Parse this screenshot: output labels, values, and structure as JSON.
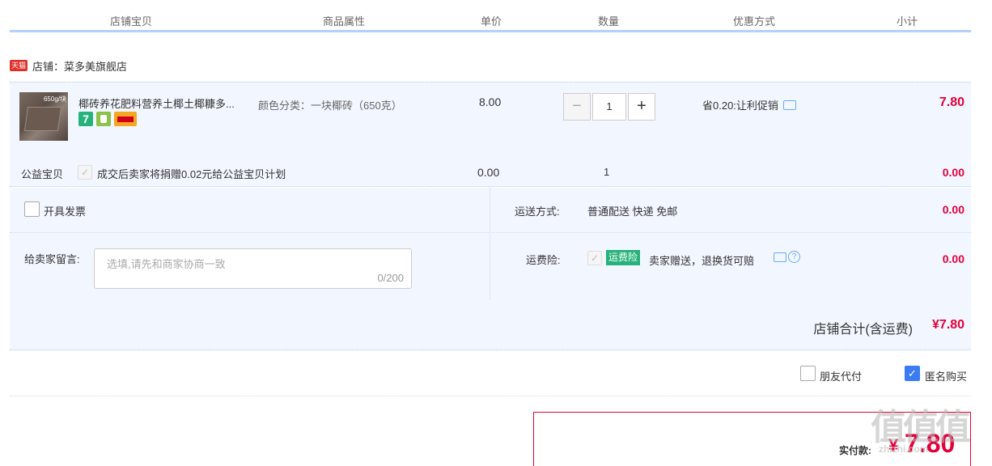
{
  "columns": {
    "shop_item": "店铺宝贝",
    "attributes": "商品属性",
    "unit_price": "单价",
    "quantity": "数量",
    "discount": "优惠方式",
    "subtotal": "小计"
  },
  "shop": {
    "badge": "天猫",
    "name": "店铺：菜多美旗舰店"
  },
  "item": {
    "thumb_tag": "650g/块",
    "title": "椰砖养花肥料营养土椰土椰糠多...",
    "attribute": "颜色分类：一块椰砖（650克）",
    "price": "8.00",
    "qty_minus": "−",
    "qty_value": "1",
    "qty_plus": "+",
    "badge_7": "7",
    "promo": "省0.20:让利促销",
    "subtotal": "7.80"
  },
  "charity": {
    "label": "公益宝贝",
    "text": "成交后卖家将捐赠0.02元给公益宝贝计划",
    "price": "0.00",
    "qty": "1",
    "subtotal": "0.00"
  },
  "invoice": {
    "label": "开具发票"
  },
  "shipping": {
    "label": "运送方式:",
    "value": "普通配送 快递 免邮",
    "subtotal": "0.00"
  },
  "message": {
    "label": "给卖家留言:",
    "placeholder": "选填,请先和商家协商一致",
    "count": "0/200"
  },
  "insurance": {
    "label": "运费险:",
    "badge": "运费险",
    "text": "卖家赠送，退换货可赔",
    "subtotal": "0.00"
  },
  "shop_total": {
    "label": "店铺合计(含运费)",
    "value": "¥7.80"
  },
  "pay_options": {
    "friend_pay": "朋友代付",
    "anonymous": "匿名购买"
  },
  "final": {
    "label": "实付款:",
    "yen": "¥",
    "value": "7.80"
  },
  "watermark": {
    "text": "值值值",
    "sub": "zhizhi.com"
  },
  "colors": {
    "accent_red": "#e4003a",
    "header_line": "#b2d1ff",
    "block_bg": "#f2f7ff",
    "checkbox_blue": "#3a7cf3",
    "insurance_green": "#26b27a"
  }
}
